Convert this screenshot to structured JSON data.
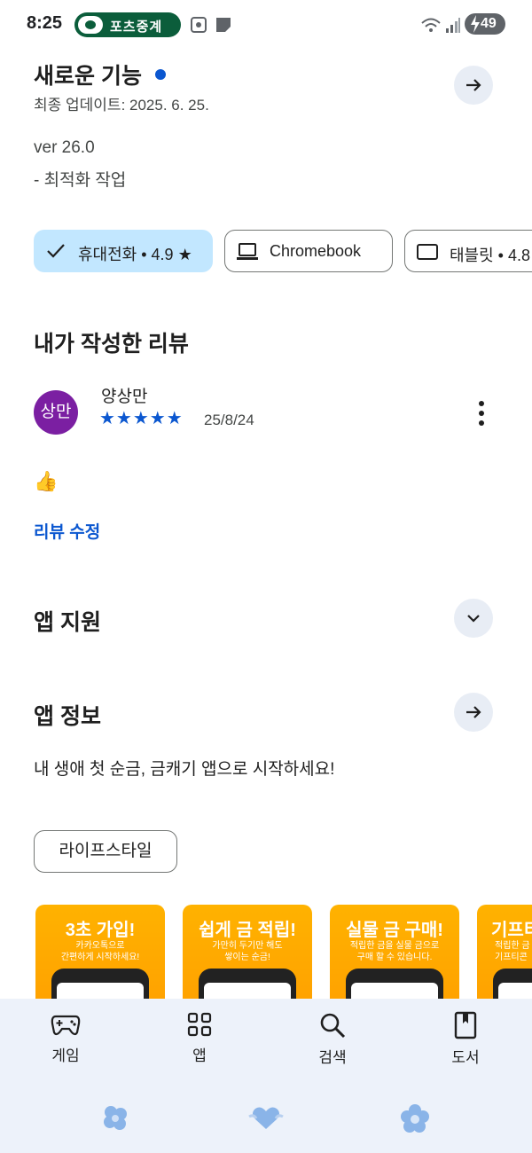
{
  "status_bar": {
    "time": "8:25",
    "notification_pill": "포츠중계",
    "battery": "49"
  },
  "whats_new": {
    "title": "새로운 기능",
    "updated": "최종 업데이트: 2025. 6. 25.",
    "version": "ver 26.0",
    "note": "- 최적화 작업"
  },
  "device_chips": [
    {
      "label": "휴대전화 • 4.9 ★",
      "selected": true,
      "icon": "check-icon"
    },
    {
      "label": "Chromebook",
      "selected": false,
      "icon": "laptop-icon"
    },
    {
      "label": "태블릿 • 4.8",
      "selected": false,
      "icon": "tablet-icon"
    }
  ],
  "my_review": {
    "heading": "내가 작성한 리뷰",
    "avatar_text": "상만",
    "author": "양상만",
    "stars": "★★★★★",
    "rating": 5,
    "date": "25/8/24",
    "content": "👍",
    "edit_link": "리뷰 수정"
  },
  "app_support": {
    "title": "앱 지원"
  },
  "app_info": {
    "title": "앱 정보",
    "description": "내 생애 첫 순금, 금캐기 앱으로 시작하세요!",
    "category_chip": "라이프스타일"
  },
  "screenshots": [
    {
      "title": "3초 가입!",
      "line1": "카카오톡으로",
      "line2": "간편하게 시작하세요!"
    },
    {
      "title": "쉽게 금 적립!",
      "line1": "가만히 두기만 해도",
      "line2": "쌓이는 순금!"
    },
    {
      "title": "실물 금 구매!",
      "line1": "적립한 금을 실물 금으로",
      "line2": "구매 할 수 있습니다."
    },
    {
      "title": "기프티",
      "line1": "적립한 금",
      "line2": "기프티콘"
    }
  ],
  "bottom_nav": [
    {
      "label": "게임",
      "icon": "gamepad-icon"
    },
    {
      "label": "앱",
      "icon": "apps-grid-icon"
    },
    {
      "label": "검색",
      "icon": "search-icon"
    },
    {
      "label": "도서",
      "icon": "book-icon"
    }
  ],
  "colors": {
    "accent": "#0b57d0",
    "chip_selected_bg": "#c2e7ff",
    "avatar_bg": "#7b1fa2",
    "screenshot_bg": "#ffa800",
    "nav_bg": "#edf2fa"
  }
}
